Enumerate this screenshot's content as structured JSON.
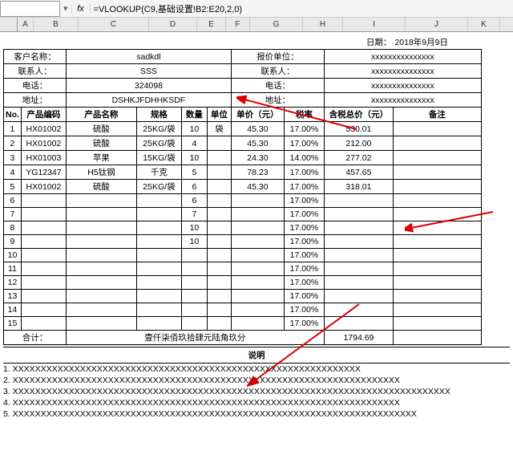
{
  "formula_bar": {
    "name_box": "",
    "fx_label": "fx",
    "formula": "=VLOOKUP(C9,基础设置!B2:E20,2,0)"
  },
  "columns": [
    "A",
    "B",
    "C",
    "D",
    "E",
    "F",
    "G",
    "H",
    "I",
    "J",
    "K"
  ],
  "date_row": {
    "label": "日期：",
    "value": "2018年9月9日"
  },
  "header": {
    "customer_label": "客户名称：",
    "customer_value": "sadkdl",
    "quoter_label": "报价单位：",
    "quoter_value": "xxxxxxxxxxxxxxx",
    "contact_label": "联系人：",
    "contact_value": "SSS",
    "contact2_label": "联系人：",
    "contact2_value": "xxxxxxxxxxxxxxx",
    "phone_label": "电话：",
    "phone_value": "324098",
    "phone2_label": "电话：",
    "phone2_value": "xxxxxxxxxxxxxxx",
    "addr_label": "地址：",
    "addr_value": "DSHKJFDHHKSDF",
    "addr2_label": "地址：",
    "addr2_value": "xxxxxxxxxxxxxxx"
  },
  "table_headers": {
    "no": "No.",
    "code": "产品编码",
    "name": "产品名称",
    "spec": "规格",
    "qty": "数量",
    "unit": "单位",
    "price": "单价（元）",
    "tax": "税率",
    "total": "含税总价（元）",
    "remark": "备注"
  },
  "rows": [
    {
      "no": "1",
      "code": "HX01002",
      "name": "硫酸",
      "spec": "25KG/袋",
      "qty": "10",
      "unit": "袋",
      "price": "45.30",
      "tax": "17.00%",
      "total": "530.01",
      "remark": ""
    },
    {
      "no": "2",
      "code": "HX01002",
      "name": "硫酸",
      "spec": "25KG/袋",
      "qty": "4",
      "unit": "",
      "price": "45.30",
      "tax": "17.00%",
      "total": "212.00",
      "remark": ""
    },
    {
      "no": "3",
      "code": "HX01003",
      "name": "苹果",
      "spec": "15KG/袋",
      "qty": "10",
      "unit": "",
      "price": "24.30",
      "tax": "14.00%",
      "total": "277.02",
      "remark": ""
    },
    {
      "no": "4",
      "code": "YG12347",
      "name": "H5钛钢",
      "spec": "千克",
      "qty": "5",
      "unit": "",
      "price": "78.23",
      "tax": "17.00%",
      "total": "457.65",
      "remark": ""
    },
    {
      "no": "5",
      "code": "HX01002",
      "name": "硫酸",
      "spec": "25KG/袋",
      "qty": "6",
      "unit": "",
      "price": "45.30",
      "tax": "17.00%",
      "total": "318.01",
      "remark": ""
    },
    {
      "no": "6",
      "code": "",
      "name": "",
      "spec": "",
      "qty": "6",
      "unit": "",
      "price": "",
      "tax": "17.00%",
      "total": "",
      "remark": ""
    },
    {
      "no": "7",
      "code": "",
      "name": "",
      "spec": "",
      "qty": "7",
      "unit": "",
      "price": "",
      "tax": "17.00%",
      "total": "",
      "remark": ""
    },
    {
      "no": "8",
      "code": "",
      "name": "",
      "spec": "",
      "qty": "10",
      "unit": "",
      "price": "",
      "tax": "17.00%",
      "total": "",
      "remark": ""
    },
    {
      "no": "9",
      "code": "",
      "name": "",
      "spec": "",
      "qty": "10",
      "unit": "",
      "price": "",
      "tax": "17.00%",
      "total": "",
      "remark": ""
    },
    {
      "no": "10",
      "code": "",
      "name": "",
      "spec": "",
      "qty": "",
      "unit": "",
      "price": "",
      "tax": "17.00%",
      "total": "",
      "remark": ""
    },
    {
      "no": "11",
      "code": "",
      "name": "",
      "spec": "",
      "qty": "",
      "unit": "",
      "price": "",
      "tax": "17.00%",
      "total": "",
      "remark": ""
    },
    {
      "no": "12",
      "code": "",
      "name": "",
      "spec": "",
      "qty": "",
      "unit": "",
      "price": "",
      "tax": "17.00%",
      "total": "",
      "remark": ""
    },
    {
      "no": "13",
      "code": "",
      "name": "",
      "spec": "",
      "qty": "",
      "unit": "",
      "price": "",
      "tax": "17.00%",
      "total": "",
      "remark": ""
    },
    {
      "no": "14",
      "code": "",
      "name": "",
      "spec": "",
      "qty": "",
      "unit": "",
      "price": "",
      "tax": "17.00%",
      "total": "",
      "remark": ""
    },
    {
      "no": "15",
      "code": "",
      "name": "",
      "spec": "",
      "qty": "",
      "unit": "",
      "price": "",
      "tax": "17.00%",
      "total": "",
      "remark": ""
    }
  ],
  "footer": {
    "sum_label": "合计：",
    "sum_cn": "壹仟柒佰玖拾肆元陆角玖分",
    "sum_num": "1794.69"
  },
  "desc": {
    "title": "说明",
    "lines": [
      "1. XXXXXXXXXXXXXXXXXXXXXXXXXXXXXXXXXXXXXXXXXXXXXXXXXXXXXXXXXXXXXX",
      "2. XXXXXXXXXXXXXXXXXXXXXXXXXXXXXXXXXXXXXXXXXXXXXXXXXXXXXXXXXXXXXXXXXXXXX",
      "3. XXXXXXXXXXXXXXXXXXXXXXXXXXXXXXXXXXXXXXXXXXXXXXXXXXXXXXXXXXXXXXXXXXXXXXXXXXXXXX",
      "4. XXXXXXXXXXXXXXXXXXXXXXXXXXXXXXXXXXXXXXXXXXXXXXXXXXXXXXXXXXXXXXXXXXXXX",
      "5. XXXXXXXXXXXXXXXXXXXXXXXXXXXXXXXXXXXXXXXXXXXXXXXXXXXXXXXXXXXXXXXXXXXXXXXX"
    ]
  }
}
